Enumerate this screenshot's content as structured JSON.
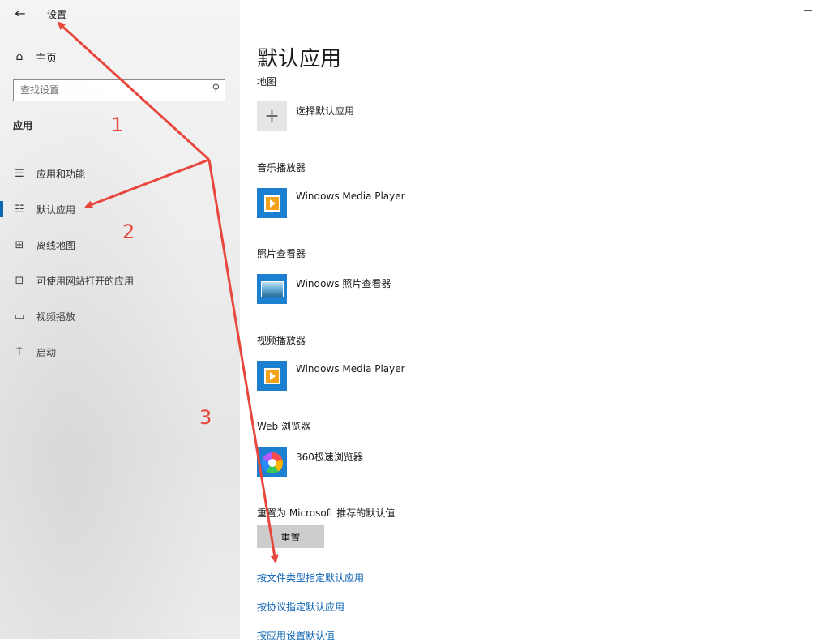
{
  "window": {
    "title": "设置",
    "back_icon": "back-arrow-icon"
  },
  "sidebar": {
    "home": {
      "label": "主页",
      "icon": "home-icon"
    },
    "search": {
      "placeholder": "查找设置",
      "icon": "search-icon"
    },
    "section_title": "应用",
    "items": [
      {
        "label": "应用和功能",
        "icon": "apps-list-icon"
      },
      {
        "label": "默认应用",
        "icon": "default-apps-icon",
        "active": true
      },
      {
        "label": "离线地图",
        "icon": "offline-map-icon"
      },
      {
        "label": "可使用网站打开的应用",
        "icon": "website-app-icon"
      },
      {
        "label": "视频播放",
        "icon": "video-icon"
      },
      {
        "label": "启动",
        "icon": "startup-icon"
      }
    ]
  },
  "main": {
    "title": "默认应用",
    "categories": [
      {
        "label": "地图",
        "app": "选择默认应用",
        "icon": "plus-icon"
      },
      {
        "label": "音乐播放器",
        "app": "Windows Media Player",
        "icon": "wmp-icon"
      },
      {
        "label": "照片查看器",
        "app": "Windows 照片查看器",
        "icon": "photo-viewer-icon"
      },
      {
        "label": "视频播放器",
        "app": "Windows Media Player",
        "icon": "wmp-icon"
      },
      {
        "label": "Web 浏览器",
        "app": "360极速浏览器",
        "icon": "browser-360-icon"
      }
    ],
    "reset_label": "重置为 Microsoft 推荐的默认值",
    "reset_button": "重置",
    "links": [
      "按文件类型指定默认应用",
      "按协议指定默认应用",
      "按应用设置默认值"
    ]
  },
  "annotations": {
    "numbers": [
      "1",
      "2",
      "3"
    ],
    "color": "#e8473e"
  },
  "colors": {
    "accent": "#0063b1",
    "link": "#0a62b3",
    "tile": "#1c7fd0"
  }
}
